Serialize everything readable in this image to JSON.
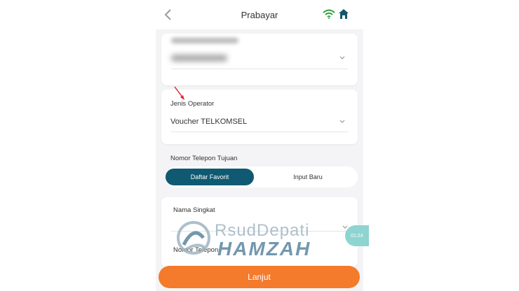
{
  "header": {
    "title": "Prabayar"
  },
  "form": {
    "operator_label": "Jenis Operator",
    "operator_value": "Voucher TELKOMSEL",
    "phone_section_label": "Nomor Telepon Tujuan",
    "tabs": [
      {
        "label": "Daftar Favorit",
        "active": true
      },
      {
        "label": "Input Baru",
        "active": false
      }
    ],
    "short_name_label": "Nama Singkat",
    "phone_number_label": "Nomor Telepon"
  },
  "timer": {
    "text": "01:24"
  },
  "watermark": {
    "line1": "RsudDepati",
    "line2": "HAMZAH"
  },
  "submit": {
    "label": "Lanjut"
  },
  "icons": {
    "back": "chevron-left-icon",
    "wifi": "wifi-icon",
    "home": "home-icon",
    "dropdown": "chevron-down-icon",
    "annotation": "red-arrow-icon"
  },
  "colors": {
    "primary": "#0f5a72",
    "accent": "#f47a2c",
    "wifi": "#2e9e3a",
    "home": "#15566b"
  }
}
